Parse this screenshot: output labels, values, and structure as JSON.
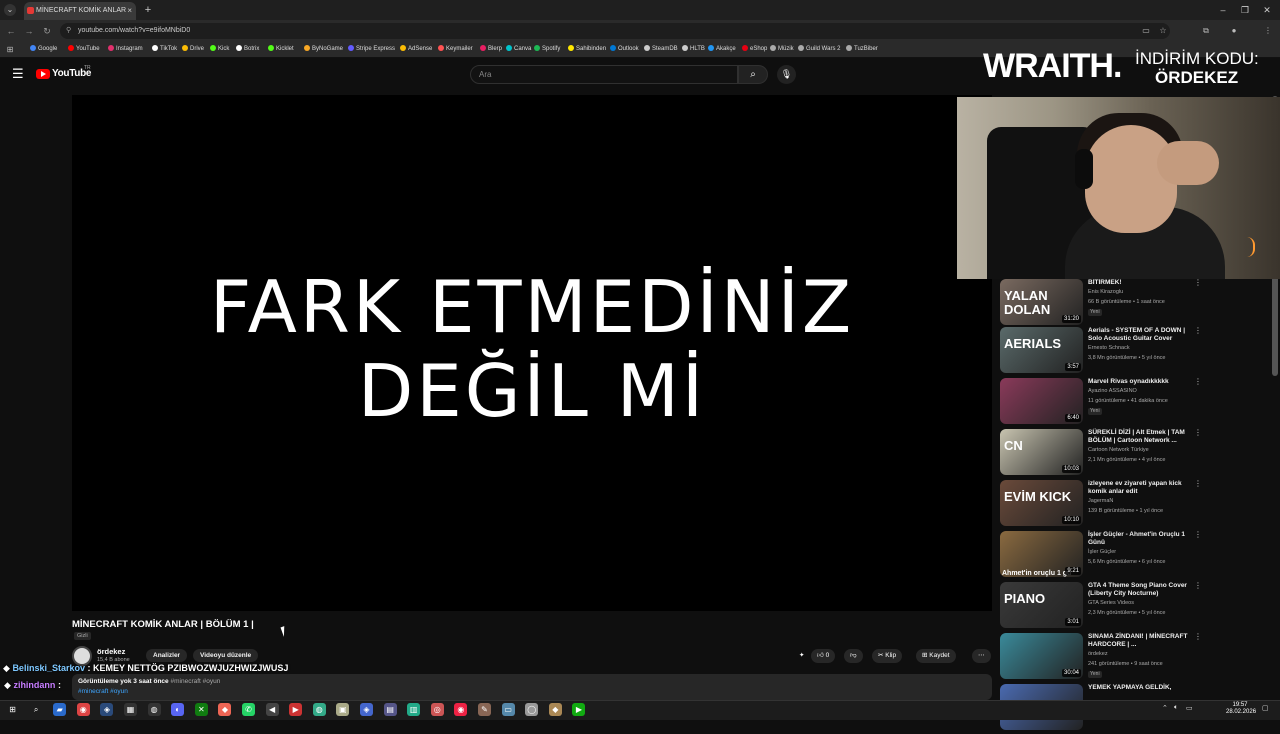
{
  "browser": {
    "tab_title": "MİNECRAFT KOMİK ANLAR",
    "tab_close": "×",
    "new_tab": "+",
    "url": "youtube.com/watch?v=e9ifoMNbiD0",
    "bookmarks": [
      {
        "label": "Google",
        "color": "#4285f4"
      },
      {
        "label": "YouTube",
        "color": "#ff0000"
      },
      {
        "label": "Instagram",
        "color": "#e1306c"
      },
      {
        "label": "TikTok",
        "color": "#ffffff"
      },
      {
        "label": "Drive",
        "color": "#fbbc04"
      },
      {
        "label": "Kick",
        "color": "#53fc18"
      },
      {
        "label": "Botrix",
        "color": "#ffffff"
      },
      {
        "label": "Kicklet",
        "color": "#53fc18"
      },
      {
        "label": "ByNoGame",
        "color": "#f9a825"
      },
      {
        "label": "Stripe Express",
        "color": "#635bff"
      },
      {
        "label": "AdSense",
        "color": "#fbbc04"
      },
      {
        "label": "Keymailer",
        "color": "#ff5252"
      },
      {
        "label": "Blerp",
        "color": "#e91e63"
      },
      {
        "label": "Canva",
        "color": "#00c4cc"
      },
      {
        "label": "Spotify",
        "color": "#1db954"
      },
      {
        "label": "Sahibinden",
        "color": "#ffe800"
      },
      {
        "label": "Outlook",
        "color": "#0078d4"
      },
      {
        "label": "SteamDB",
        "color": "#cccccc"
      },
      {
        "label": "HLTB",
        "color": "#cccccc"
      },
      {
        "label": "Akakçe",
        "color": "#2196f3"
      },
      {
        "label": "eShop",
        "color": "#e60012"
      },
      {
        "label": "Müzik",
        "color": "#aaaaaa"
      },
      {
        "label": "Guild Wars 2",
        "color": "#aaaaaa"
      },
      {
        "label": "TuzBiber",
        "color": "#aaaaaa"
      }
    ]
  },
  "youtube": {
    "logo": "YouTube",
    "logo_region": "TR",
    "search_placeholder": "Ara"
  },
  "player": {
    "line1": "FARK ETMEDİNİZ",
    "line2": "DEĞİL Mİ"
  },
  "overlay": {
    "brand": "WRAITH.",
    "promo_line1": "İNDİRİM KODU:",
    "promo_line2": "ÖRDEKEZ"
  },
  "video": {
    "title": "MİNECRAFT KOMİK ANLAR | BÖLÜM 1 |",
    "visibility": "Gizli",
    "channel": "ördekez",
    "subscribers": "15,4 B abone",
    "btn_analytics": "Analizler",
    "btn_edit": "Videoyu düzenle",
    "likes": "0",
    "btn_clip": "Klip",
    "btn_save": "Kaydet",
    "desc_stats": "Görüntüleme yok  3 saat önce",
    "desc_tags_inline": "#minecraft #oyun",
    "desc_tags": "#minecraft #oyun"
  },
  "chat": [
    {
      "user": "Belinski_Starkov",
      "message": ": KEMEY NETTÖG PZIBWOZWJUZHWIZJWUSJ"
    },
    {
      "user": "zihindann",
      "message": ":"
    }
  ],
  "recommendations": [
    {
      "title": "BİTİRMEK!",
      "channel": "Enis Kirazoglu",
      "meta": "66 B görüntüleme • 1 saat önce",
      "badge": "Yeni",
      "duration": "31:20",
      "thumb_text": "YALAN DOLAN",
      "thumb_color": "#7a6a60"
    },
    {
      "title": "Aerials - SYSTEM OF A DOWN | Solo Acoustic Guitar Cover",
      "channel": "Ernesto Schnack",
      "meta": "3,8 Mn görüntüleme • 5 yıl önce",
      "badge": "",
      "duration": "3:57",
      "thumb_text": "AERIALS",
      "thumb_color": "#5a6a6a"
    },
    {
      "title": "Marvel Rivas oynadıkkkkk",
      "channel": "Ayazino ASSASINO",
      "meta": "11 görüntüleme • 41 dakika önce",
      "badge": "Yeni",
      "duration": "6:40",
      "thumb_text": "",
      "thumb_color": "#8a3a5a"
    },
    {
      "title": "SÜREKLİ DİZİ | Alt Etmek | TAM BÖLÜM | Cartoon Network ...",
      "channel": "Cartoon Network Türkiye",
      "meta": "2,1 Mn görüntüleme • 4 yıl önce",
      "badge": "",
      "duration": "10:03",
      "thumb_text": "CN",
      "thumb_color": "#c8c4b0"
    },
    {
      "title": "izleyene ev ziyareti yapan kick komik anlar edit",
      "channel": "JagermaN",
      "meta": "139 B görüntüleme • 1 yıl önce",
      "badge": "",
      "duration": "10:10",
      "thumb_text": "EVİM KICK",
      "thumb_color": "#6a4a3a"
    },
    {
      "title": "İşler Güçler - Ahmet'in Oruçlu 1 Günü",
      "channel": "İşler Güçler",
      "meta": "5,6 Mn görüntüleme • 6 yıl önce",
      "badge": "",
      "duration": "9:21",
      "thumb_text": "Ahmet'in oruçlu 1 gü",
      "thumb_color": "#8a6a40"
    },
    {
      "title": "GTA 4 Theme Song Piano Cover (Liberty City Nocturne)",
      "channel": "GTA Series Videos",
      "meta": "2,3 Mn görüntüleme • 5 yıl önce",
      "badge": "",
      "duration": "3:01",
      "thumb_text": "PIANO",
      "thumb_color": "#3a3a3a"
    },
    {
      "title": "SINAMA ZİNDANI! | MİNECRAFT HARDCORE | ...",
      "channel": "ördekez",
      "meta": "241 görüntüleme • 9 saat önce",
      "badge": "Yeni",
      "duration": "30:04",
      "thumb_text": "",
      "thumb_color": "#3a8a9a"
    },
    {
      "title": "YEMEK YAPMAYA GELDİK,",
      "channel": "",
      "meta": "",
      "badge": "",
      "duration": "",
      "thumb_text": "",
      "thumb_color": "#4a6ab0"
    }
  ],
  "taskbar": {
    "time": "19:57",
    "date": "28.02.2026"
  }
}
